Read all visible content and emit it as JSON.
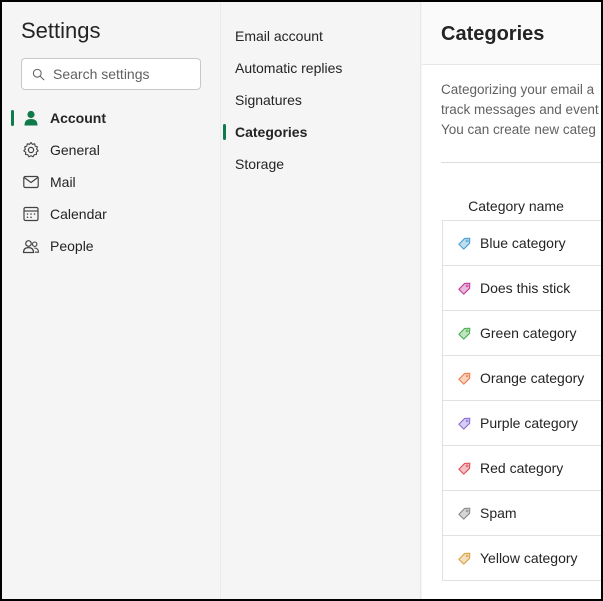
{
  "settings": {
    "title": "Settings",
    "search_placeholder": "Search settings"
  },
  "nav": [
    {
      "label": "Account",
      "icon": "person-icon",
      "active": true
    },
    {
      "label": "General",
      "icon": "gear-icon",
      "active": false
    },
    {
      "label": "Mail",
      "icon": "mail-icon",
      "active": false
    },
    {
      "label": "Calendar",
      "icon": "calendar-icon",
      "active": false
    },
    {
      "label": "People",
      "icon": "people-icon",
      "active": false
    }
  ],
  "subnav": [
    {
      "label": "Email account",
      "active": false
    },
    {
      "label": "Automatic replies",
      "active": false
    },
    {
      "label": "Signatures",
      "active": false
    },
    {
      "label": "Categories",
      "active": true
    },
    {
      "label": "Storage",
      "active": false
    }
  ],
  "panel": {
    "title": "Categories",
    "description_lines": [
      "Categorizing your email a",
      "track messages and event",
      "You can create new categ"
    ],
    "column_header": "Category name"
  },
  "categories": [
    {
      "label": "Blue category",
      "color": "#4a9fd5"
    },
    {
      "label": "Does this stick",
      "color": "#c23a9a"
    },
    {
      "label": "Green category",
      "color": "#4caf50"
    },
    {
      "label": "Orange category",
      "color": "#e8804a"
    },
    {
      "label": "Purple category",
      "color": "#8b6fd6"
    },
    {
      "label": "Red category",
      "color": "#e0505a"
    },
    {
      "label": "Spam",
      "color": "#8a8a8a"
    },
    {
      "label": "Yellow category",
      "color": "#d9a444"
    }
  ],
  "colors": {
    "accent": "#0f7b4a"
  }
}
